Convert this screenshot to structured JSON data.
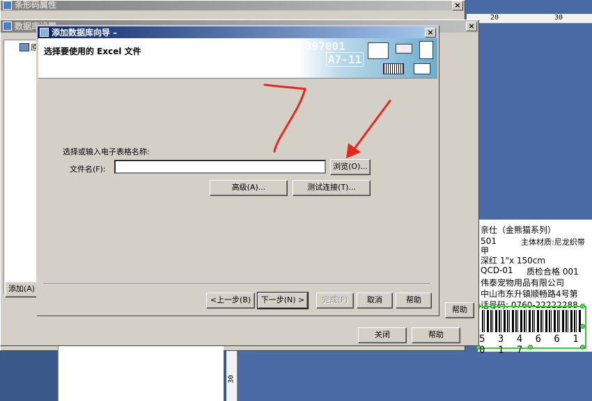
{
  "barcode_window": {
    "title": "条形码属性"
  },
  "db_window": {
    "title": "数据库设置",
    "tree_item": "原",
    "add_button": "添加(A)",
    "help_button": "帮助",
    "close_button": "关闭",
    "help_button2": "帮助"
  },
  "wizard": {
    "title": "添加数据库向导 –",
    "heading": "选择要使用的 Excel 文件",
    "banner_watermark_1": "397001",
    "banner_watermark_2": "A7-11",
    "prompt_label": "选择或输入电子表格名称:",
    "filename_label": "文件名(F):",
    "filename_value": "",
    "browse_button": "浏览(O)...",
    "advanced_button": "高级(A)...",
    "test_connection_button": "测试连接(T)...",
    "back_button": "<上一步(B)",
    "next_button": "下一步(N) >",
    "finish_button": "完成(F)",
    "cancel_button": "取消",
    "help_button": "帮助"
  },
  "ruler": {
    "mark_20": "20",
    "mark_30": "30",
    "left_mark_30": "30"
  },
  "label_preview": {
    "line1": "亲仕（金熊猫系列）",
    "line2a": "501",
    "line2b": "主体材质:尼龙织带",
    "line3": "甲",
    "line4": "深红 1\"x 150cm",
    "line5a": "QCD-01",
    "line5b": "质检合格 001",
    "line6": "伟泰宠物用品有限公司",
    "line7": "中山市东升镇顺畅路4号第",
    "line8": "话号码: 0760-22222288",
    "barcode_digits": "5 3 4 6 6 1 0 1 7"
  },
  "colors": {
    "annotation_red": "#e8261c",
    "selection_green": "#3cc33c"
  }
}
